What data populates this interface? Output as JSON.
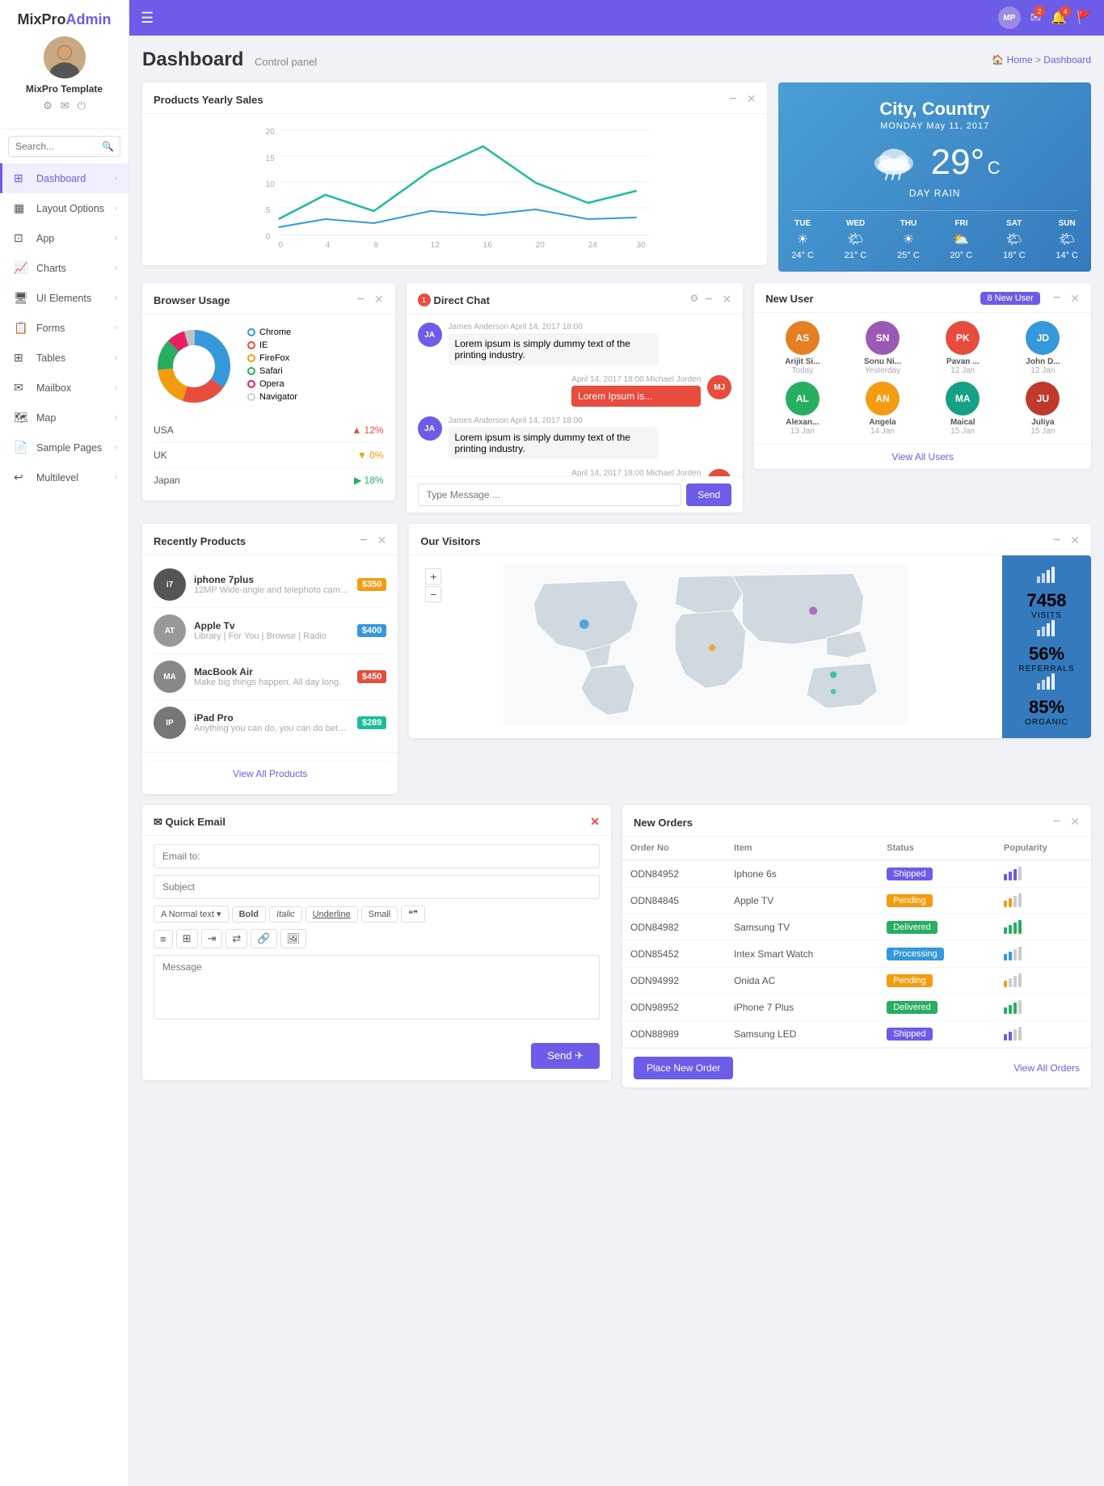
{
  "brand": {
    "name_part1": "MixPro",
    "name_part2": "Admin"
  },
  "user": {
    "name": "MixPro Template",
    "avatar_initials": "MP"
  },
  "search": {
    "placeholder": "Search..."
  },
  "nav": {
    "items": [
      {
        "id": "dashboard",
        "label": "Dashboard",
        "icon": "⊞",
        "active": true
      },
      {
        "id": "layout",
        "label": "Layout Options",
        "icon": "▦",
        "active": false
      },
      {
        "id": "app",
        "label": "App",
        "icon": "⊡",
        "active": false
      },
      {
        "id": "charts",
        "label": "Charts",
        "icon": "📈",
        "active": false
      },
      {
        "id": "ui-elements",
        "label": "UI Elements",
        "icon": "🖥",
        "active": false
      },
      {
        "id": "forms",
        "label": "Forms",
        "icon": "📋",
        "active": false
      },
      {
        "id": "tables",
        "label": "Tables",
        "icon": "⊞",
        "active": false
      },
      {
        "id": "mailbox",
        "label": "Mailbox",
        "icon": "✉",
        "active": false
      },
      {
        "id": "map",
        "label": "Map",
        "icon": "🗺",
        "active": false
      },
      {
        "id": "sample-pages",
        "label": "Sample Pages",
        "icon": "📄",
        "active": false
      },
      {
        "id": "multilevel",
        "label": "Multilevel",
        "icon": "↩",
        "active": false
      }
    ]
  },
  "page": {
    "title": "Dashboard",
    "subtitle": "Control panel",
    "breadcrumb_home": "Home",
    "breadcrumb_current": "Dashboard"
  },
  "products_chart": {
    "title": "Products Yearly Sales",
    "x_labels": [
      "0",
      "4",
      "8",
      "12",
      "16",
      "20",
      "24",
      "30"
    ],
    "y_labels": [
      "0",
      "5",
      "10",
      "15",
      "20"
    ]
  },
  "weather": {
    "city": "City,",
    "country": "Country",
    "day": "MONDAY",
    "date": "May 11, 2017",
    "temp": "29°",
    "unit": "C",
    "desc": "DAY RAIN",
    "forecast": [
      {
        "day": "TUE",
        "icon": "☀",
        "temp": "24° C"
      },
      {
        "day": "WED",
        "icon": "🌤",
        "temp": "21° C"
      },
      {
        "day": "THU",
        "icon": "☀",
        "temp": "25° C"
      },
      {
        "day": "FRI",
        "icon": "⛅",
        "temp": "20° C"
      },
      {
        "day": "SAT",
        "icon": "🌤",
        "temp": "18° C"
      },
      {
        "day": "SUN",
        "icon": "🌤",
        "temp": "14° C"
      }
    ]
  },
  "browser_usage": {
    "title": "Browser Usage",
    "items": [
      {
        "label": "Chrome",
        "color": "#3498db",
        "type": "ring",
        "pct": 35
      },
      {
        "label": "IE",
        "color": "#e74c3c",
        "type": "ring",
        "pct": 20
      },
      {
        "label": "FireFox",
        "color": "#f39c12",
        "type": "ring",
        "pct": 18
      },
      {
        "label": "Safari",
        "color": "#27ae60",
        "type": "ring",
        "pct": 14
      },
      {
        "label": "Opera",
        "color": "#e91e63",
        "type": "ring",
        "pct": 8
      },
      {
        "label": "Navigator",
        "color": "#ccc",
        "type": "ring",
        "pct": 5
      }
    ],
    "stats": [
      {
        "label": "USA",
        "value": "12%",
        "dir": "up"
      },
      {
        "label": "UK",
        "value": "0%",
        "dir": "down"
      },
      {
        "label": "Japan",
        "value": "18%",
        "dir": "up2"
      }
    ]
  },
  "direct_chat": {
    "title": "Direct Chat",
    "messages": [
      {
        "sender": "James Anderson",
        "time": "April 14, 2017 18:00",
        "text": "Lorem ipsum is simply dummy text of the printing industry.",
        "align": "left",
        "initials": "JA",
        "color": "#6c5ce7",
        "red": false
      },
      {
        "sender": "Michael Jorden",
        "time": "April 14, 2017 18:00",
        "text": "Lorem Ipsum is...",
        "align": "right",
        "initials": "MJ",
        "color": "#e74c3c",
        "red": true
      },
      {
        "sender": "James Anderson",
        "time": "April 14, 2017 18:00",
        "text": "Lorem ipsum is simply dummy text of the printing industry.",
        "align": "left",
        "initials": "JA",
        "color": "#6c5ce7",
        "red": false
      },
      {
        "sender": "Michael Jorden",
        "time": "April 14, 2017 18:00",
        "text": "",
        "align": "right",
        "initials": "MJ",
        "color": "#e74c3c",
        "red": false
      }
    ],
    "input_placeholder": "Type Message ...",
    "send_label": "Send",
    "notif_count": "1"
  },
  "new_user": {
    "title": "New User",
    "badge_label": "8 New User",
    "users": [
      {
        "name": "Arijit Si...",
        "date": "Today",
        "color": "#e67e22",
        "initials": "AS"
      },
      {
        "name": "Sonu Ni...",
        "date": "Yesterday",
        "color": "#9b59b6",
        "initials": "SN"
      },
      {
        "name": "Pavan ...",
        "date": "12 Jan",
        "color": "#e74c3c",
        "initials": "PK"
      },
      {
        "name": "John D...",
        "date": "12 Jan",
        "color": "#3498db",
        "initials": "JD"
      },
      {
        "name": "Alexan...",
        "date": "13 Jan",
        "color": "#27ae60",
        "initials": "AL"
      },
      {
        "name": "Angela",
        "date": "14 Jan",
        "color": "#f39c12",
        "initials": "AN"
      },
      {
        "name": "Maical",
        "date": "15 Jan",
        "color": "#16a085",
        "initials": "MA"
      },
      {
        "name": "Juliya",
        "date": "15 Jan",
        "color": "#c0392b",
        "initials": "JU"
      }
    ],
    "view_all_label": "View All Users"
  },
  "recently_products": {
    "title": "Recently Products",
    "products": [
      {
        "name": "iphone 7plus",
        "desc": "12MP Wide-angle and telephoto cameras.",
        "price": "$350",
        "price_color": "#f39c12",
        "initials": "i7",
        "color": "#555"
      },
      {
        "name": "Apple Tv",
        "desc": "Library | For You | Browse | Radio",
        "price": "$400",
        "price_color": "#3498db",
        "initials": "AT",
        "color": "#999"
      },
      {
        "name": "MacBook Air",
        "desc": "Make big things happen. All day long.",
        "price": "$450",
        "price_color": "#e74c3c",
        "initials": "MA",
        "color": "#888"
      },
      {
        "name": "iPad Pro",
        "desc": "Anything you can do, you can do better.",
        "price": "$289",
        "price_color": "#1abc9c",
        "initials": "IP",
        "color": "#777"
      }
    ],
    "view_all_label": "View All Products"
  },
  "visitors": {
    "title": "Our Visitors",
    "stats": [
      {
        "num": "7458",
        "label": "VISITS",
        "icon": "📊"
      },
      {
        "num": "56%",
        "label": "REFERRALS",
        "icon": "📊"
      },
      {
        "num": "85%",
        "label": "ORGANIC",
        "icon": "📊"
      }
    ]
  },
  "quick_email": {
    "title": "Quick Email",
    "to_placeholder": "Email to:",
    "subject_placeholder": "Subject",
    "message_placeholder": "Message",
    "toolbar_buttons": [
      "Normal text ▾",
      "Bold",
      "Italic",
      "Underline",
      "Small",
      "❝❞"
    ],
    "icon_buttons": [
      "≡",
      "⊞",
      "⇥",
      "⇄",
      "🔗",
      "🖼"
    ],
    "send_label": "Send ✈"
  },
  "new_orders": {
    "title": "New Orders",
    "columns": [
      "Order No",
      "Item",
      "Status",
      "Popularity"
    ],
    "orders": [
      {
        "order_no": "ODN84952",
        "item": "Iphone 6s",
        "status": "Shipped",
        "status_class": "status-shipped",
        "bars": [
          "#6c5ce7",
          "#6c5ce7",
          "#6c5ce7",
          "#ccc"
        ]
      },
      {
        "order_no": "ODN84845",
        "item": "Apple TV",
        "status": "Pending",
        "status_class": "status-pending",
        "bars": [
          "#f39c12",
          "#f39c12",
          "#ccc",
          "#ccc"
        ]
      },
      {
        "order_no": "ODN84982",
        "item": "Samsung TV",
        "status": "Delivered",
        "status_class": "status-delivered",
        "bars": [
          "#27ae60",
          "#27ae60",
          "#27ae60",
          "#27ae60"
        ]
      },
      {
        "order_no": "ODN85452",
        "item": "Intex Smart Watch",
        "status": "Processing",
        "status_class": "status-processing",
        "bars": [
          "#3498db",
          "#3498db",
          "#ccc",
          "#ccc"
        ]
      },
      {
        "order_no": "ODN94992",
        "item": "Onida AC",
        "status": "Pending",
        "status_class": "status-pending",
        "bars": [
          "#f39c12",
          "#ccc",
          "#ccc",
          "#ccc"
        ]
      },
      {
        "order_no": "ODN98952",
        "item": "iPhone 7 Plus",
        "status": "Delivered",
        "status_class": "status-delivered",
        "bars": [
          "#27ae60",
          "#27ae60",
          "#27ae60",
          "#ccc"
        ]
      },
      {
        "order_no": "ODN88989",
        "item": "Samsung LED",
        "status": "Shipped",
        "status_class": "status-shipped",
        "bars": [
          "#6c5ce7",
          "#6c5ce7",
          "#ccc",
          "#ccc"
        ]
      }
    ],
    "place_order_label": "Place New Order",
    "view_all_label": "View All Orders"
  }
}
